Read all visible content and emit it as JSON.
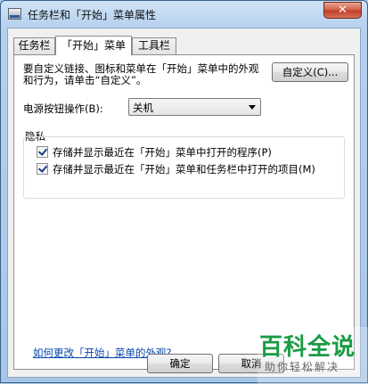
{
  "window": {
    "title": "任务栏和「开始」菜单属性",
    "close_label": "✕"
  },
  "tabs": [
    {
      "label": "任务栏",
      "active": false
    },
    {
      "label": "「开始」菜单",
      "active": true
    },
    {
      "label": "工具栏",
      "active": false
    }
  ],
  "start_menu": {
    "description": "要自定义链接、图标和菜单在「开始」菜单中的外观和行为，请单击“自定义”。",
    "customize_label": "自定义(C)...",
    "power_label": "电源按钮操作(B):",
    "power_value": "关机",
    "privacy_label": "隐私",
    "check_programs": "存储并显示最近在「开始」菜单中打开的程序(P)",
    "check_items": "存储并显示最近在「开始」菜单和任务栏中打开的项目(M)",
    "link_text": "如何更改「开始」菜单的外观?"
  },
  "footer": {
    "ok_label": "确定",
    "cancel_label": "取消"
  },
  "watermark": {
    "main": "百科全说",
    "sub": "助你轻松解决"
  }
}
